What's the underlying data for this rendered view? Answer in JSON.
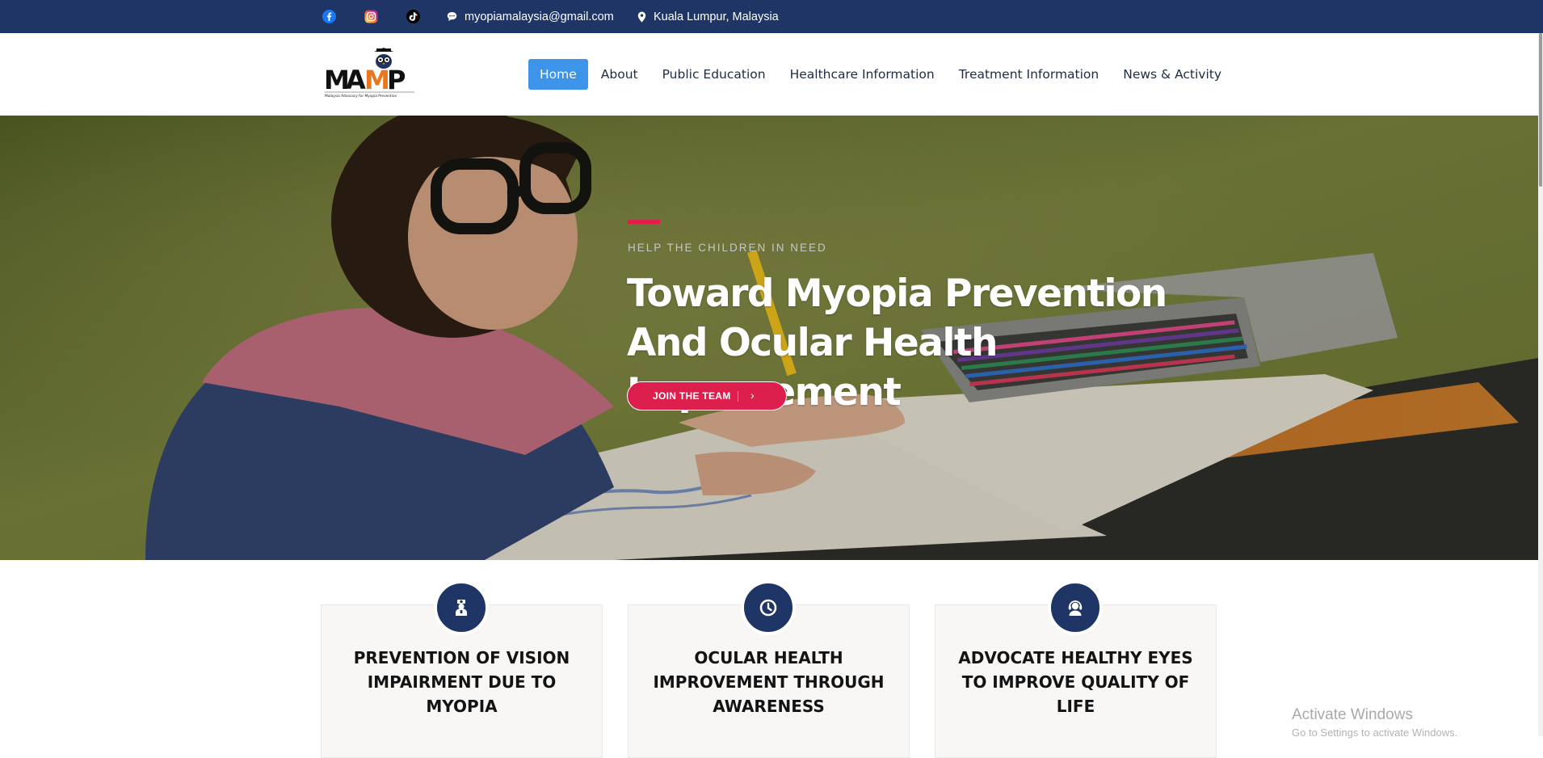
{
  "topbar": {
    "social": [
      {
        "icon": "facebook-icon",
        "color": "#1877f2"
      },
      {
        "icon": "instagram-icon",
        "color": "#e1306c"
      },
      {
        "icon": "tiktok-icon",
        "color": "#000000"
      }
    ],
    "email": "myopiamalaysia@gmail.com",
    "location": "Kuala Lumpur, Malaysia",
    "background": "#1e3566"
  },
  "header": {
    "logo": {
      "text": "MAMP",
      "tagline": "Malaysia Advocacy for Myopia Prevention"
    },
    "nav": [
      {
        "label": "Home",
        "active": true
      },
      {
        "label": "About"
      },
      {
        "label": "Public Education"
      },
      {
        "label": "Healthcare Information"
      },
      {
        "label": "Treatment Information"
      },
      {
        "label": "News & Activity"
      }
    ],
    "active_color": "#3d94e8"
  },
  "hero": {
    "kicker": "HELP THE CHILDREN IN NEED",
    "title_line1": "Toward Myopia Prevention",
    "title_line2": "And Ocular Health Improvement",
    "cta_label": "JOIN THE TEAM",
    "cta_chevron": "›",
    "accent_color": "#e21d4c"
  },
  "cards": [
    {
      "icon": "doctor-icon",
      "title": "PREVENTION OF VISION IMPAIRMENT DUE TO MYOPIA"
    },
    {
      "icon": "clock-icon",
      "title": "OCULAR HEALTH IMPROVEMENT THROUGH AWARENESS"
    },
    {
      "icon": "support-agent-icon",
      "title": "ADVOCATE HEALTHY EYES TO IMPROVE QUALITY OF LIFE"
    }
  ],
  "watermark": {
    "line1": "Activate Windows",
    "line2": "Go to Settings to activate Windows."
  }
}
